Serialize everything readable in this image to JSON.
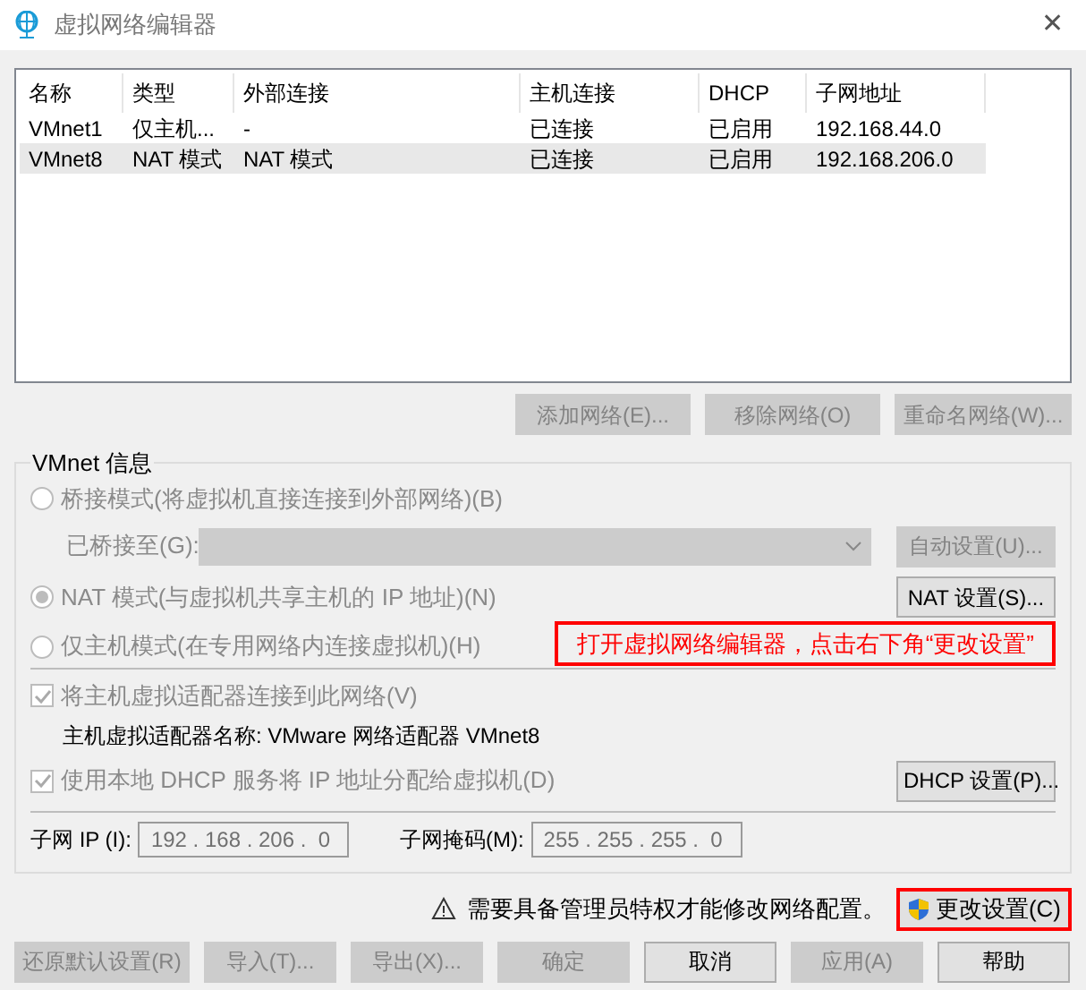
{
  "window": {
    "title": "虚拟网络编辑器",
    "close": "✕"
  },
  "table": {
    "columns": [
      "名称",
      "类型",
      "外部连接",
      "主机连接",
      "DHCP",
      "子网地址"
    ],
    "rows": [
      {
        "cells": [
          "VMnet1",
          "仅主机...",
          "-",
          "已连接",
          "已启用",
          "192.168.44.0"
        ],
        "selected": false
      },
      {
        "cells": [
          "VMnet8",
          "NAT 模式",
          "NAT 模式",
          "已连接",
          "已启用",
          "192.168.206.0"
        ],
        "selected": true
      }
    ]
  },
  "network_buttons": [
    {
      "label": "添加网络(E)...",
      "disabled": true
    },
    {
      "label": "移除网络(O)",
      "disabled": true
    },
    {
      "label": "重命名网络(W)...",
      "disabled": true
    }
  ],
  "vmnet_info": {
    "title": "VMnet 信息",
    "bridged": {
      "label": "桥接模式(将虚拟机直接连接到外部网络)(B)",
      "selected": false,
      "disabled": true
    },
    "bridged_to": {
      "label": "已桥接至(G):",
      "disabled": true,
      "button": {
        "label": "自动设置(U)...",
        "disabled": true
      }
    },
    "nat": {
      "label": "NAT 模式(与虚拟机共享主机的 IP 地址)(N)",
      "selected": true,
      "disabled": true,
      "button": {
        "label": "NAT 设置(S)...",
        "disabled": false
      }
    },
    "host_only": {
      "label": "仅主机模式(在专用网络内连接虚拟机)(H)",
      "selected": false,
      "disabled": true
    },
    "annotation": "打开虚拟网络编辑器，点击右下角“更改设置”",
    "connect_adapter": {
      "label": "将主机虚拟适配器连接到此网络(V)",
      "checked": true,
      "disabled": true
    },
    "adapter_name": "主机虚拟适配器名称: VMware 网络适配器 VMnet8",
    "use_dhcp": {
      "label": "使用本地 DHCP 服务将 IP 地址分配给虚拟机(D)",
      "checked": true,
      "disabled": true,
      "button": {
        "label": "DHCP 设置(P)...",
        "disabled": false
      }
    },
    "subnet_ip": {
      "label": "子网 IP (I):",
      "value": "192 . 168 . 206 .  0"
    },
    "subnet_mask": {
      "label": "子网掩码(M):",
      "value": "255 . 255 . 255 .  0"
    }
  },
  "admin_notice": {
    "text": "需要具备管理员特权才能修改网络配置。",
    "button": "更改设置(C)"
  },
  "footer_buttons": [
    {
      "label": "还原默认设置(R)",
      "disabled": true
    },
    {
      "label": "导入(T)...",
      "disabled": true
    },
    {
      "label": "导出(X)...",
      "disabled": true
    },
    {
      "label": "确定",
      "disabled": true
    },
    {
      "label": "取消",
      "disabled": false
    },
    {
      "label": "应用(A)",
      "disabled": true
    },
    {
      "label": "帮助",
      "disabled": false
    }
  ]
}
